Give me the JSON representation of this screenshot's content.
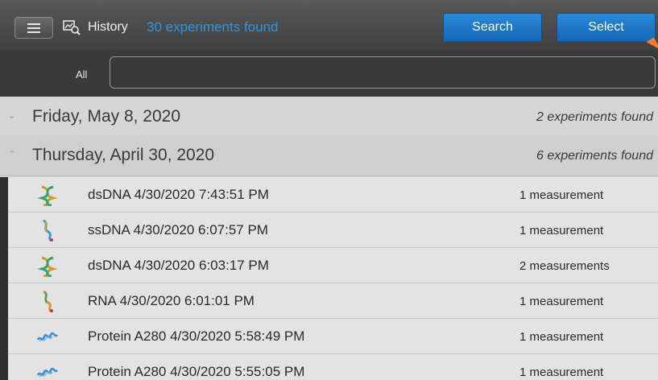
{
  "header": {
    "menu_icon": "hamburger-icon",
    "history_icon": "history-search-icon",
    "title": "History",
    "found": "30 experiments found",
    "search_label": "Search",
    "select_label": "Select",
    "accent": "#2f95dc"
  },
  "filter": {
    "label": "All",
    "value": ""
  },
  "groups": [
    {
      "date": "Friday, May 8, 2020",
      "count": "2 experiments found",
      "expanded": false
    },
    {
      "date": "Thursday, April 30, 2020",
      "count": "6 experiments found",
      "expanded": true
    }
  ],
  "rows": [
    {
      "icon": "dsdna-helix-icon",
      "name": "dsDNA 4/30/2020 7:43:51 PM",
      "measurements": "1 measurement"
    },
    {
      "icon": "ssdna-strand-icon",
      "name": "ssDNA 4/30/2020 6:07:57 PM",
      "measurements": "1 measurement"
    },
    {
      "icon": "dsdna-helix-icon",
      "name": "dsDNA 4/30/2020 6:03:17 PM",
      "measurements": "2 measurements"
    },
    {
      "icon": "rna-strand-icon",
      "name": "RNA 4/30/2020 6:01:01 PM",
      "measurements": "1 measurement"
    },
    {
      "icon": "protein-icon",
      "name": "Protein A280 4/30/2020 5:58:49 PM",
      "measurements": "1 measurement"
    },
    {
      "icon": "protein-icon",
      "name": "Protein A280 4/30/2020 5:55:05 PM",
      "measurements": "1 measurement"
    }
  ]
}
